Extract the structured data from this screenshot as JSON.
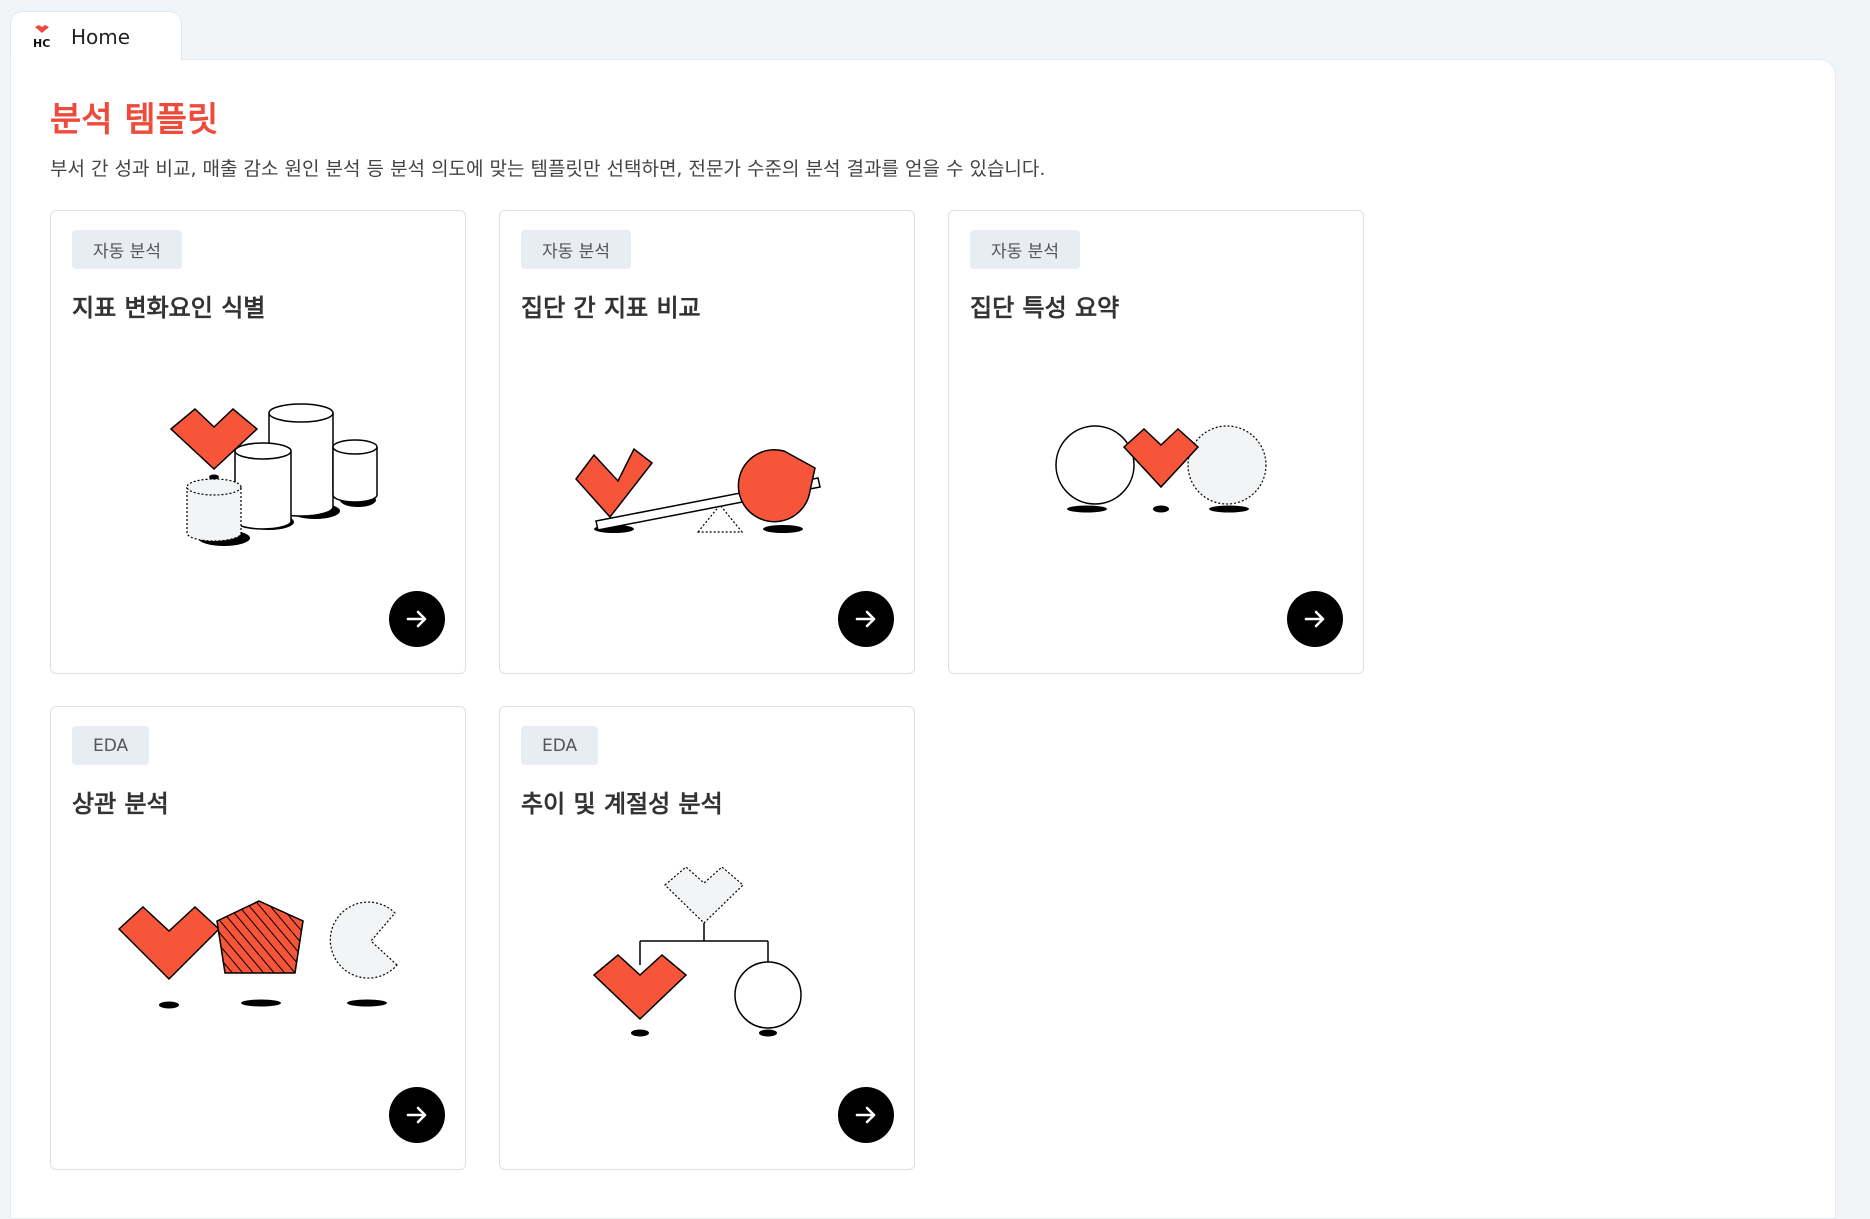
{
  "tab": {
    "label": "Home",
    "logo_icon": "hc-heart-logo-icon"
  },
  "page": {
    "title": "분석 템플릿",
    "subtitle": "부서 간 성과 비교, 매출 감소 원인 분석 등 분석 의도에 맞는 템플릿만 선택하면, 전문가 수준의 분석 결과를 얻을 수 있습니다."
  },
  "templates": [
    {
      "badge": "자동 분석",
      "title": "지표 변화요인 식별",
      "illustration": "heart-and-cylinders-illustration"
    },
    {
      "badge": "자동 분석",
      "title": "집단 간 지표 비교",
      "illustration": "seesaw-illustration"
    },
    {
      "badge": "자동 분석",
      "title": "집단 특성 요약",
      "illustration": "heart-between-circles-illustration"
    },
    {
      "badge": "EDA",
      "title": "상관 분석",
      "illustration": "heart-pentagon-pacman-illustration"
    },
    {
      "badge": "EDA",
      "title": "추이 및 계절성 분석",
      "illustration": "tree-diagram-illustration"
    }
  ],
  "colors": {
    "accent": "#ef4b3a",
    "shape_fill": "#f7553a",
    "badge_bg": "#e8edf3",
    "button_bg": "#000000"
  },
  "icons": {
    "open_button": "arrow-right-icon"
  }
}
